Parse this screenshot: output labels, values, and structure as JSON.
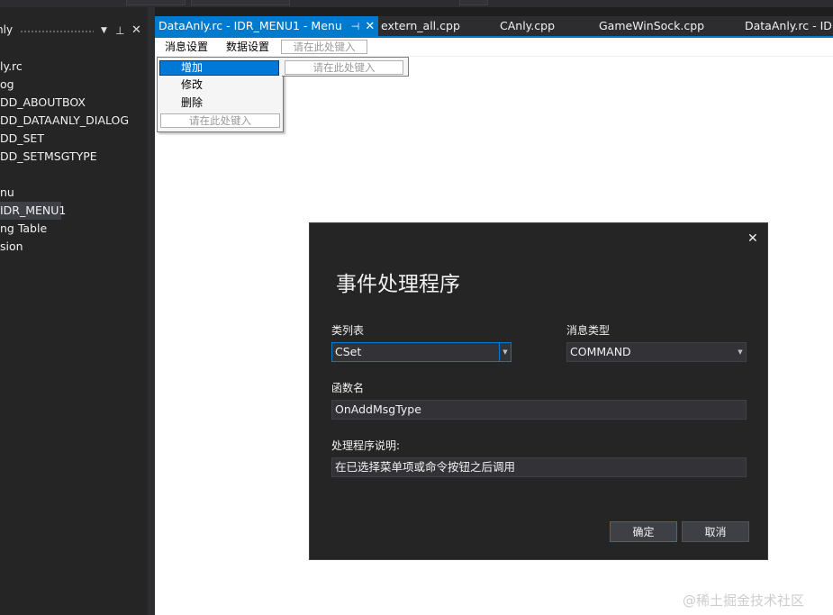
{
  "left_panel": {
    "title": "nly",
    "dropdown_icon": "▼",
    "pin_icon": "⊥",
    "close_icon": "✕",
    "tree_items": [
      {
        "label": "ly.rc",
        "selected": false
      },
      {
        "label": "og",
        "selected": false
      },
      {
        "label": "DD_ABOUTBOX",
        "selected": false
      },
      {
        "label": "DD_DATAANLY_DIALOG",
        "selected": false
      },
      {
        "label": "DD_SET",
        "selected": false
      },
      {
        "label": "DD_SETMSGTYPE",
        "selected": false
      },
      {
        "label": "",
        "selected": false
      },
      {
        "label": "nu",
        "selected": false
      },
      {
        "label": "IDR_MENU1",
        "selected": true
      },
      {
        "label": "ng Table",
        "selected": false
      },
      {
        "label": "sion",
        "selected": false
      }
    ]
  },
  "tabs": [
    {
      "label": "DataAnly.rc - IDR_MENU1 - Menu",
      "active": true,
      "pin": "⊣",
      "close": "✕"
    },
    {
      "label": "extern_all.cpp",
      "active": false
    },
    {
      "label": "CAnly.cpp",
      "active": false
    },
    {
      "label": "GameWinSock.cpp",
      "active": false
    },
    {
      "label": "DataAnly.rc - ID...",
      "active": false
    }
  ],
  "menu_editor": {
    "menus": [
      "消息设置",
      "数据设置"
    ],
    "type_here": "请在此处键入",
    "dropdown_items": [
      {
        "label": "增加",
        "highlighted": true
      },
      {
        "label": "修改",
        "highlighted": false
      },
      {
        "label": "删除",
        "highlighted": false
      }
    ]
  },
  "dialog": {
    "close_icon": "✕",
    "title": "事件处理程序",
    "class_list_label": "类列表",
    "class_list_value": "CSet",
    "message_type_label": "消息类型",
    "message_type_value": "COMMAND",
    "function_name_label": "函数名",
    "function_name_value": "OnAddMsgType",
    "handler_desc_label": "处理程序说明:",
    "handler_desc_value": "在已选择菜单项或命令按钮之后调用",
    "ok_label": "确定",
    "cancel_label": "取消"
  },
  "watermark": "@稀土掘金技术社区",
  "colors": {
    "accent": "#007acc",
    "background": "#1e1e1e",
    "panel": "#252526",
    "highlight": "#0078d7"
  }
}
